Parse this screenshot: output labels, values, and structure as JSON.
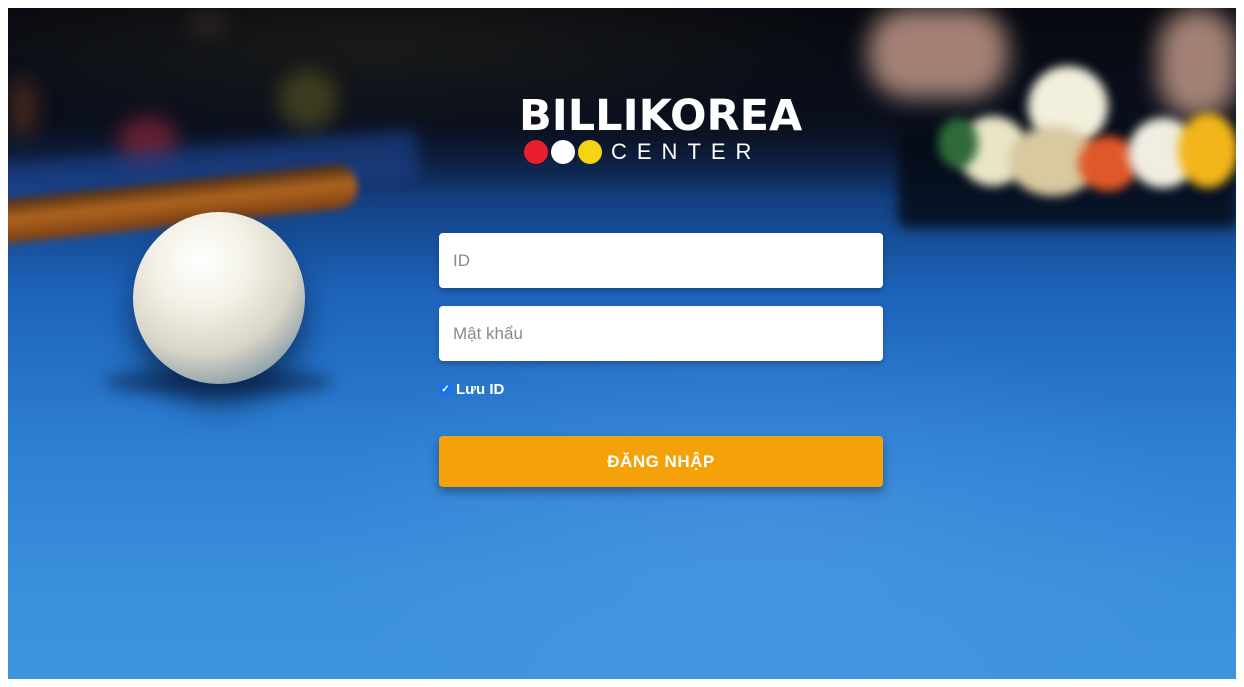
{
  "logo": {
    "title": "BILLIKOREA",
    "subtitle": "CENTER",
    "dot_colors": [
      "#e8202d",
      "#ffffff",
      "#f4d312"
    ]
  },
  "form": {
    "id_placeholder": "ID",
    "id_value": "",
    "password_placeholder": "Mật khẩu",
    "password_value": "",
    "remember_label": "Lưu ID",
    "remember_checked": true,
    "login_label": "ĐĂNG NHẬP"
  },
  "colors": {
    "accent": "#f5a20a",
    "checkbox": "#1a73e8",
    "table_blue": "#2d7fd2"
  }
}
